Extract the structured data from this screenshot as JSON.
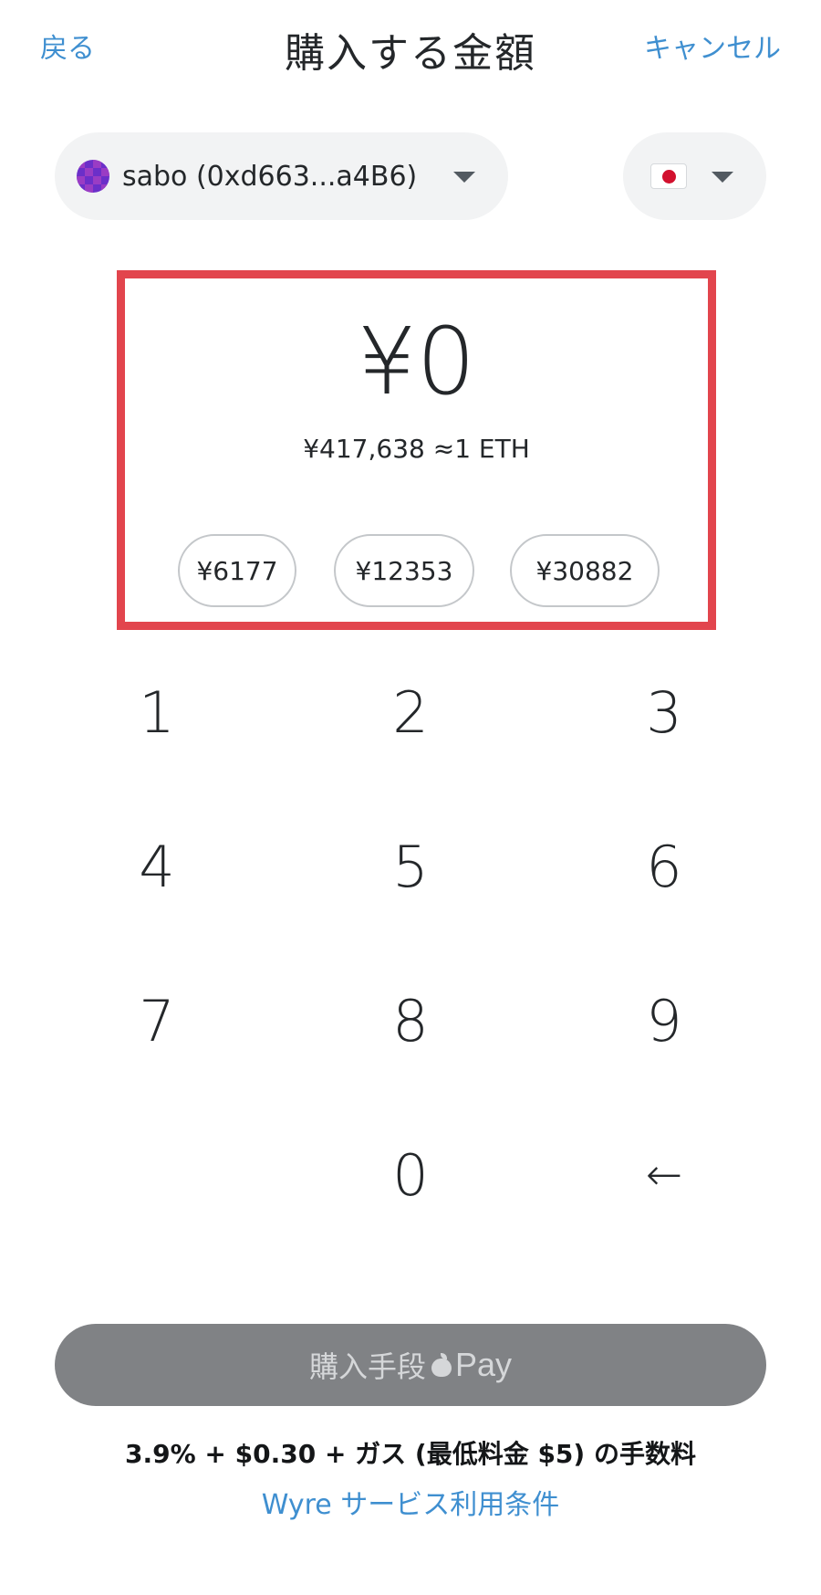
{
  "header": {
    "back_label": "戻る",
    "title": "購入する金額",
    "cancel_label": "キャンセル"
  },
  "account": {
    "label": "sabo (0xd663...a4B6)",
    "avatar_icon": "identicon-avatar",
    "avatar_color": "#6b2fc9"
  },
  "currency": {
    "flag_icon": "japan-flag-icon"
  },
  "amount": {
    "value": "¥0",
    "rate": "¥417,638 ≈1 ETH",
    "presets": [
      "¥6177",
      "¥12353",
      "¥30882"
    ],
    "highlight_color": "#e2454d"
  },
  "keypad": {
    "keys": [
      "1",
      "2",
      "3",
      "4",
      "5",
      "6",
      "7",
      "8",
      "9",
      "0"
    ],
    "backspace_icon": "←"
  },
  "purchase": {
    "button_label": "購入手段",
    "pay_label": "Pay",
    "button_color": "#808285"
  },
  "footer": {
    "fee_text": "3.9% + $0.30 + ガス (最低料金 $5) の手数料",
    "terms_link": "Wyre サービス利用条件",
    "link_color": "#3f8fd0"
  }
}
